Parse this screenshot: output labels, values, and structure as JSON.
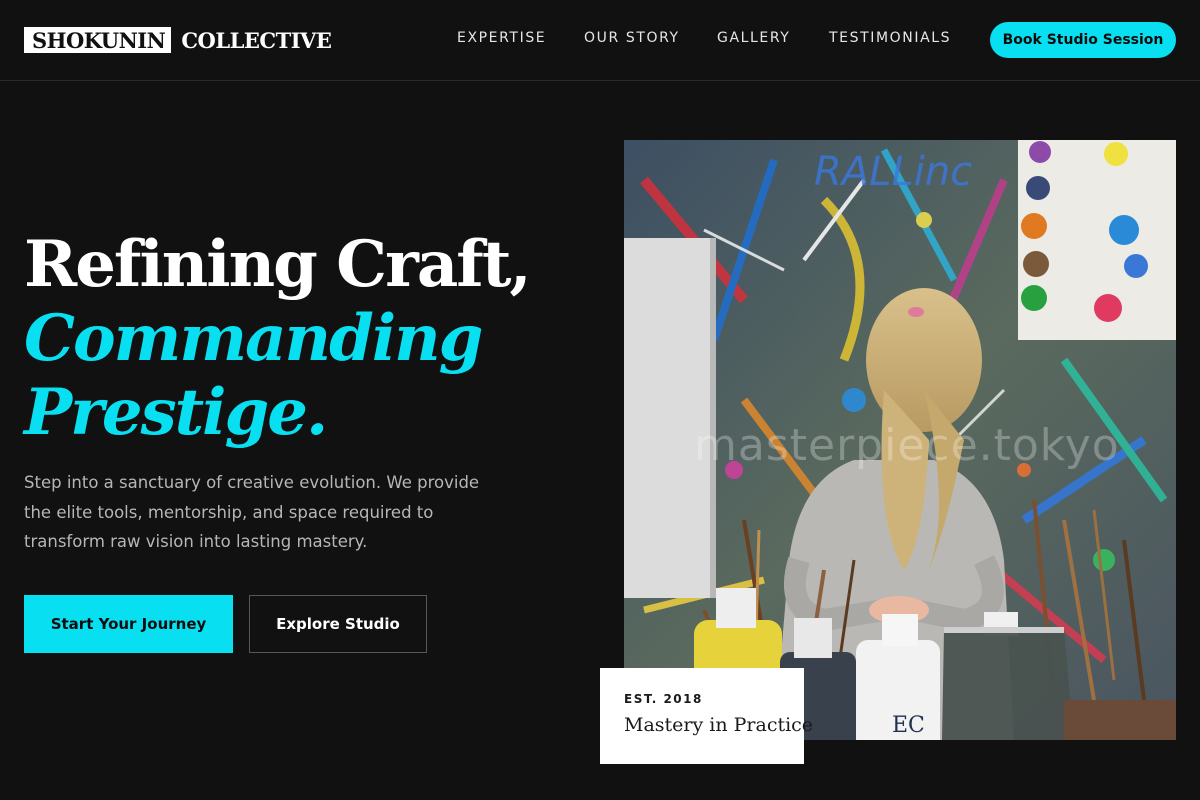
{
  "brand": {
    "boxed": "SHOKUNIN",
    "plain": "COLLECTIVE"
  },
  "nav": {
    "links": [
      "EXPERTISE",
      "OUR STORY",
      "GALLERY",
      "TESTIMONIALS"
    ],
    "cta": "Book Studio Session"
  },
  "hero": {
    "title_line1": "Refining Craft,",
    "title_line2": "Commanding",
    "title_line3": "Prestige.",
    "copy": "Step into a sanctuary of creative evolution. We provide the elite tools, mentorship, and space required to transform raw vision into lasting mastery.",
    "primary_cta": "Start Your Journey",
    "secondary_cta": "Explore Studio"
  },
  "image": {
    "watermark": "masterpiece.tokyo",
    "wall_text": "RALLinc"
  },
  "badge": {
    "label": "EST. 2018",
    "title": "Mastery in Practice"
  },
  "colors": {
    "accent": "#08e0f2",
    "background": "#111112",
    "card": "#ffffff"
  }
}
